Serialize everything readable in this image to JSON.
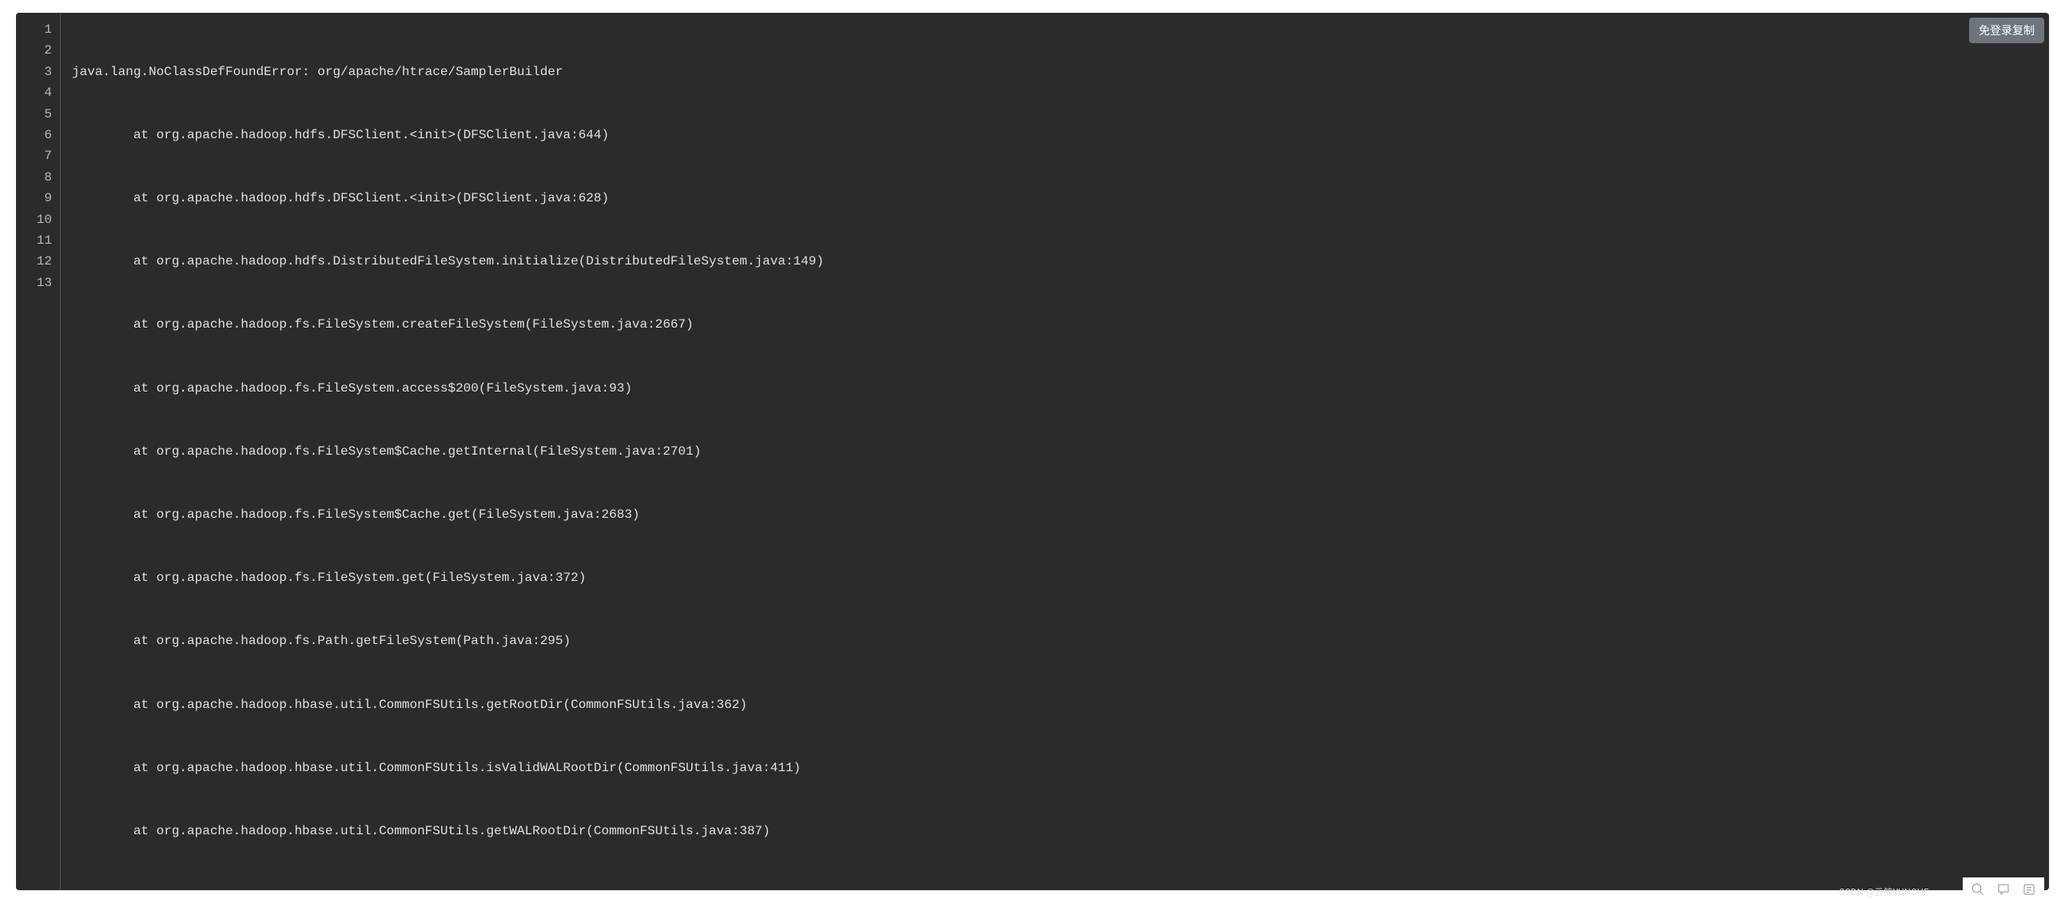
{
  "code": {
    "lines": [
      "java.lang.NoClassDefFoundError: org/apache/htrace/SamplerBuilder",
      "        at org.apache.hadoop.hdfs.DFSClient.<init>(DFSClient.java:644)",
      "        at org.apache.hadoop.hdfs.DFSClient.<init>(DFSClient.java:628)",
      "        at org.apache.hadoop.hdfs.DistributedFileSystem.initialize(DistributedFileSystem.java:149)",
      "        at org.apache.hadoop.fs.FileSystem.createFileSystem(FileSystem.java:2667)",
      "        at org.apache.hadoop.fs.FileSystem.access$200(FileSystem.java:93)",
      "        at org.apache.hadoop.fs.FileSystem$Cache.getInternal(FileSystem.java:2701)",
      "        at org.apache.hadoop.fs.FileSystem$Cache.get(FileSystem.java:2683)",
      "        at org.apache.hadoop.fs.FileSystem.get(FileSystem.java:372)",
      "        at org.apache.hadoop.fs.Path.getFileSystem(Path.java:295)",
      "        at org.apache.hadoop.hbase.util.CommonFSUtils.getRootDir(CommonFSUtils.java:362)",
      "        at org.apache.hadoop.hbase.util.CommonFSUtils.isValidWALRootDir(CommonFSUtils.java:411)",
      "        at org.apache.hadoop.hbase.util.CommonFSUtils.getWALRootDir(CommonFSUtils.java:387)"
    ],
    "line_numbers": [
      "1",
      "2",
      "3",
      "4",
      "5",
      "6",
      "7",
      "8",
      "9",
      "10",
      "11",
      "12",
      "13"
    ]
  },
  "copy_button_label": "免登录复制",
  "watermark_text": "CSDN @云鲸YUNCHE"
}
